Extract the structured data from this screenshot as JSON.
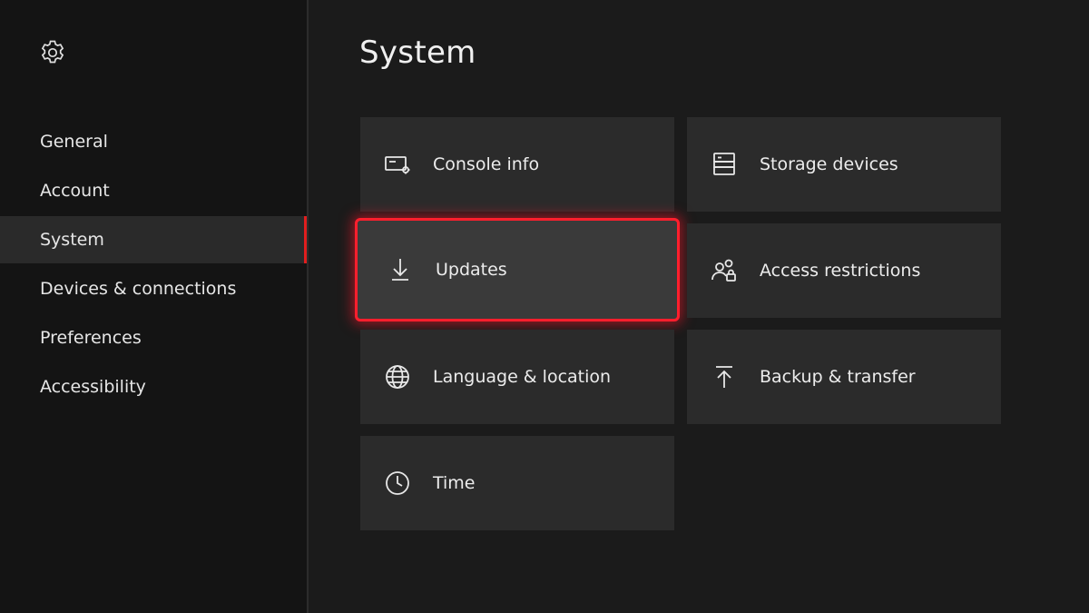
{
  "sidebar": {
    "items": [
      {
        "label": "General"
      },
      {
        "label": "Account"
      },
      {
        "label": "System",
        "active": true
      },
      {
        "label": "Devices & connections"
      },
      {
        "label": "Preferences"
      },
      {
        "label": "Accessibility"
      }
    ]
  },
  "main": {
    "title": "System",
    "tiles": [
      {
        "label": "Console info",
        "icon": "console-info-icon"
      },
      {
        "label": "Storage devices",
        "icon": "storage-icon"
      },
      {
        "label": "Updates",
        "icon": "download-icon",
        "focused": true
      },
      {
        "label": "Access restrictions",
        "icon": "people-lock-icon"
      },
      {
        "label": "Language & location",
        "icon": "globe-icon"
      },
      {
        "label": "Backup & transfer",
        "icon": "upload-icon"
      },
      {
        "label": "Time",
        "icon": "clock-icon"
      }
    ]
  },
  "colors": {
    "accent": "#e01e1e",
    "focus_border": "#ff1f2d",
    "tile_bg": "#2b2b2b",
    "sidebar_bg": "#141414",
    "background": "#1b1b1b"
  }
}
